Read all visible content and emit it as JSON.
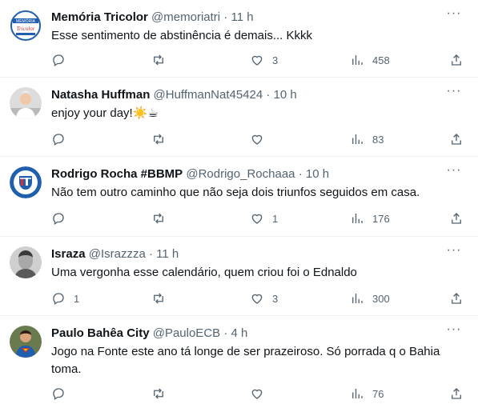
{
  "tweets": [
    {
      "name": "Memória Tricolor",
      "handle": "@memoriatri",
      "time": "11 h",
      "text": "Esse sentimento de abstinência é demais... Kkkk",
      "replies": "",
      "retweets": "",
      "likes": "3",
      "views": "458",
      "avatar_badge": [
        "MEMÓRIA",
        "Tricolor"
      ]
    },
    {
      "name": "Natasha Huffman",
      "handle": "@HuffmanNat45424",
      "time": "10 h",
      "text": "enjoy your day!☀️☕",
      "replies": "",
      "retweets": "",
      "likes": "",
      "views": "83"
    },
    {
      "name": "Rodrigo Rocha #BBMP",
      "handle": "@Rodrigo_Rochaaa",
      "time": "10 h",
      "text": "Não tem outro caminho que não seja dois triunfos seguidos em casa.",
      "replies": "",
      "retweets": "",
      "likes": "1",
      "views": "176"
    },
    {
      "name": "Israza",
      "handle": "@Israzzza",
      "time": "11 h",
      "text": "Uma vergonha esse calendário, quem criou foi o Ednaldo",
      "replies": "1",
      "retweets": "",
      "likes": "3",
      "views": "300"
    },
    {
      "name": "Paulo Bahêa City",
      "handle": "@PauloECB",
      "time": "4 h",
      "text": "Jogo na Fonte este ano tá longe de ser prazeiroso. Só porrada q o Bahia toma.",
      "replies": "",
      "retweets": "",
      "likes": "",
      "views": "76"
    }
  ],
  "colors": {
    "text_primary": "#0f1419",
    "text_secondary": "#536471",
    "divider": "#eff3f4",
    "bahia_blue": "#1f5fae",
    "bahia_red": "#d6312b"
  },
  "icons": [
    "reply-icon",
    "retweet-icon",
    "like-icon",
    "views-icon",
    "share-icon",
    "more-icon"
  ]
}
